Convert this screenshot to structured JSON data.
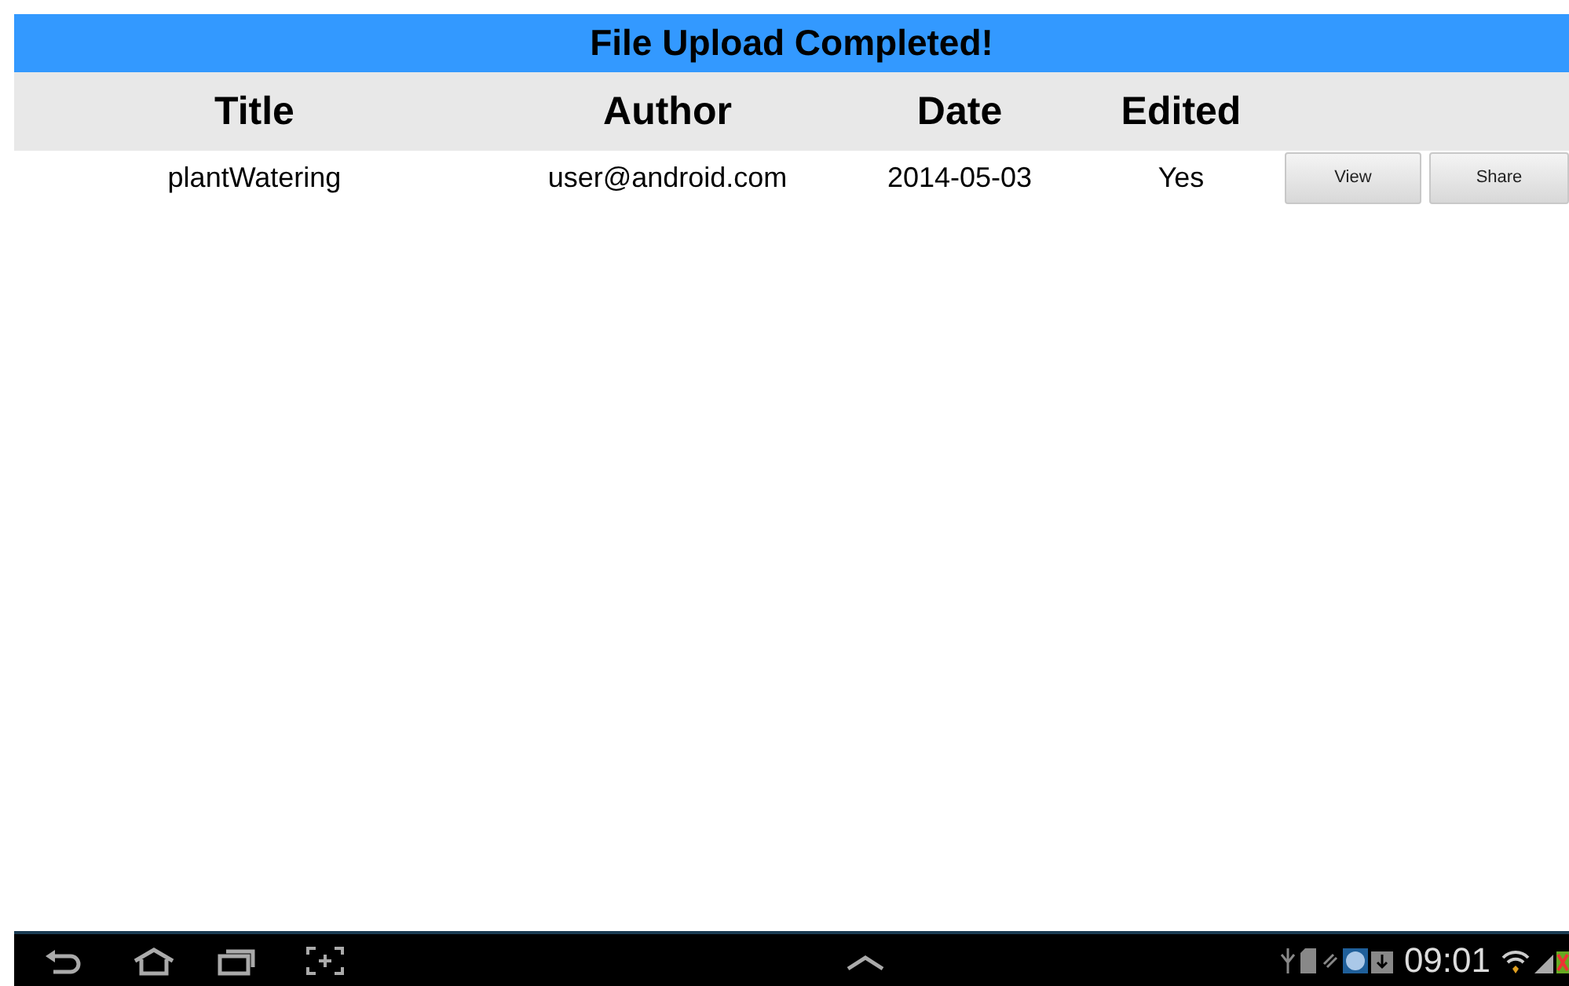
{
  "banner": {
    "title": "File Upload Completed!"
  },
  "table": {
    "columns": [
      "Title",
      "Author",
      "Date",
      "Edited"
    ],
    "rows": [
      {
        "cells": [
          "plantWatering",
          "user@android.com",
          "2014-05-03",
          "Yes"
        ],
        "actions": [
          "View",
          "Share"
        ]
      }
    ]
  },
  "status_bar": {
    "time": "09:01"
  }
}
